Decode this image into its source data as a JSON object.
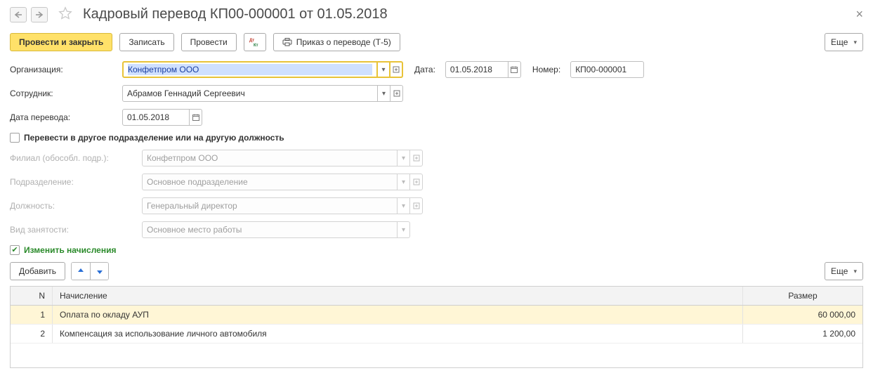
{
  "header": {
    "title": "Кадровый перевод КП00-000001 от 01.05.2018"
  },
  "toolbar": {
    "post_close": "Провести и закрыть",
    "save": "Записать",
    "post": "Провести",
    "dtct": "Дт Кт",
    "order": "Приказ о переводе (Т-5)",
    "more": "Еще"
  },
  "form": {
    "org_label": "Организация:",
    "org_value": "Конфетпром ООО",
    "date_label": "Дата:",
    "date_value": "01.05.2018",
    "number_label": "Номер:",
    "number_value": "КП00-000001",
    "employee_label": "Сотрудник:",
    "employee_value": "Абрамов Геннадий Сергеевич",
    "transfer_date_label": "Дата перевода:",
    "transfer_date_value": "01.05.2018",
    "checkbox_transfer": "Перевести в другое подразделение или на другую должность",
    "branch_label": "Филиал (обособл. подр.):",
    "branch_value": "Конфетпром ООО",
    "department_label": "Подразделение:",
    "department_value": "Основное подразделение",
    "position_label": "Должность:",
    "position_value": "Генеральный директор",
    "employment_label": "Вид занятости:",
    "employment_value": "Основное место работы",
    "change_accruals": "Изменить начисления"
  },
  "actions": {
    "add": "Добавить",
    "more": "Еще"
  },
  "table": {
    "col_n": "N",
    "col_name": "Начисление",
    "col_size": "Размер",
    "rows": [
      {
        "n": "1",
        "name": "Оплата по окладу АУП",
        "size": "60 000,00"
      },
      {
        "n": "2",
        "name": "Компенсация за использование личного автомобиля",
        "size": "1 200,00"
      }
    ]
  }
}
